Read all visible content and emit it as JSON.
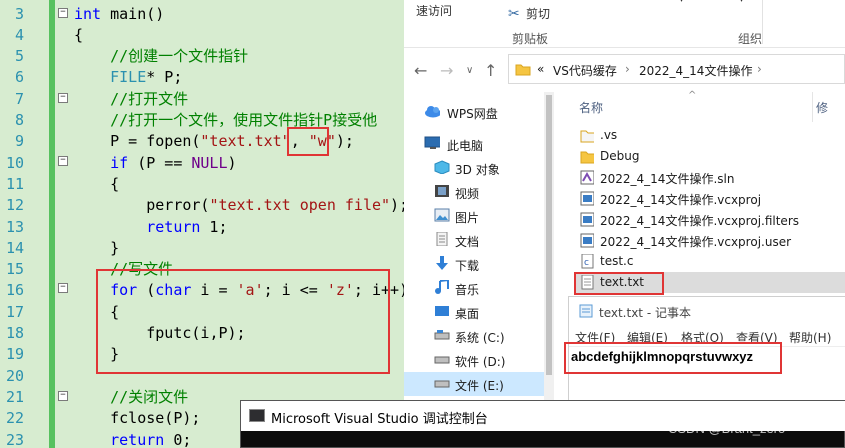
{
  "editor": {
    "lines": [
      {
        "n": "3",
        "tokens": [
          {
            "t": "int",
            "c": "kw"
          },
          {
            "t": " main()",
            "c": ""
          }
        ]
      },
      {
        "n": "4",
        "tokens": [
          {
            "t": "{",
            "c": ""
          }
        ]
      },
      {
        "n": "5",
        "tokens": [
          {
            "t": "    //创建一个文件指针",
            "c": "cm"
          }
        ]
      },
      {
        "n": "6",
        "tokens": [
          {
            "t": "    ",
            "c": ""
          },
          {
            "t": "FILE",
            "c": "ty"
          },
          {
            "t": "* P;",
            "c": ""
          }
        ]
      },
      {
        "n": "7",
        "tokens": [
          {
            "t": "    //打开文件",
            "c": "cm"
          }
        ]
      },
      {
        "n": "8",
        "tokens": [
          {
            "t": "    //打开一个文件，使用文件指针P接受他",
            "c": "cm"
          }
        ]
      },
      {
        "n": "9",
        "tokens": [
          {
            "t": "    P = fopen(",
            "c": ""
          },
          {
            "t": "\"text.txt\"",
            "c": "st"
          },
          {
            "t": ", ",
            "c": ""
          },
          {
            "t": "\"w\"",
            "c": "st"
          },
          {
            "t": ");",
            "c": ""
          }
        ]
      },
      {
        "n": "10",
        "tokens": [
          {
            "t": "    ",
            "c": ""
          },
          {
            "t": "if",
            "c": "kw"
          },
          {
            "t": " (P == ",
            "c": ""
          },
          {
            "t": "NULL",
            "c": "mc"
          },
          {
            "t": ")",
            "c": ""
          }
        ]
      },
      {
        "n": "11",
        "tokens": [
          {
            "t": "    {",
            "c": ""
          }
        ]
      },
      {
        "n": "12",
        "tokens": [
          {
            "t": "        perror(",
            "c": ""
          },
          {
            "t": "\"text.txt open file\"",
            "c": "st"
          },
          {
            "t": ");",
            "c": ""
          }
        ]
      },
      {
        "n": "13",
        "tokens": [
          {
            "t": "        ",
            "c": ""
          },
          {
            "t": "return",
            "c": "kw"
          },
          {
            "t": " 1;",
            "c": ""
          }
        ]
      },
      {
        "n": "14",
        "tokens": [
          {
            "t": "    }",
            "c": ""
          }
        ]
      },
      {
        "n": "15",
        "tokens": [
          {
            "t": "    //写文件",
            "c": "cm"
          }
        ]
      },
      {
        "n": "16",
        "tokens": [
          {
            "t": "    ",
            "c": ""
          },
          {
            "t": "for",
            "c": "kw"
          },
          {
            "t": " (",
            "c": ""
          },
          {
            "t": "char",
            "c": "kw"
          },
          {
            "t": " i = ",
            "c": ""
          },
          {
            "t": "'a'",
            "c": "st"
          },
          {
            "t": "; i <= ",
            "c": ""
          },
          {
            "t": "'z'",
            "c": "st"
          },
          {
            "t": "; i++)",
            "c": ""
          }
        ]
      },
      {
        "n": "17",
        "tokens": [
          {
            "t": "    {",
            "c": ""
          }
        ]
      },
      {
        "n": "18",
        "tokens": [
          {
            "t": "        fputc(i,P);",
            "c": ""
          }
        ]
      },
      {
        "n": "19",
        "tokens": [
          {
            "t": "    }",
            "c": ""
          }
        ]
      },
      {
        "n": "20",
        "tokens": []
      },
      {
        "n": "21",
        "tokens": [
          {
            "t": "    //关闭文件",
            "c": "cm"
          }
        ]
      },
      {
        "n": "22",
        "tokens": [
          {
            "t": "    fclose(P);",
            "c": ""
          }
        ]
      },
      {
        "n": "23",
        "tokens": [
          {
            "t": "    ",
            "c": ""
          },
          {
            "t": "return",
            "c": "kw"
          },
          {
            "t": " 0;",
            "c": ""
          }
        ]
      }
    ]
  },
  "explorer": {
    "ribbon": {
      "quick_access": "速访问",
      "cut": "剪切",
      "clipboard_group": "剪贴板",
      "organize_group": "组织"
    },
    "address": {
      "prefix": "«",
      "segments": [
        "VS代码缓存",
        "2022_4_14文件操作"
      ]
    },
    "nav_items": [
      {
        "label": "WPS网盘",
        "icon": "cloud-icon"
      },
      {
        "label": "此电脑",
        "icon": "computer-icon"
      },
      {
        "label": "3D 对象",
        "icon": "cube-icon"
      },
      {
        "label": "视频",
        "icon": "video-icon"
      },
      {
        "label": "图片",
        "icon": "picture-icon"
      },
      {
        "label": "文档",
        "icon": "document-icon"
      },
      {
        "label": "下载",
        "icon": "download-icon"
      },
      {
        "label": "音乐",
        "icon": "music-icon"
      },
      {
        "label": "桌面",
        "icon": "desktop-icon"
      },
      {
        "label": "系统 (C:)",
        "icon": "drive-icon"
      },
      {
        "label": "软件 (D:)",
        "icon": "drive-icon"
      },
      {
        "label": "文件 (E:)",
        "icon": "drive-icon"
      }
    ],
    "column_name": "名称",
    "column_more": "修",
    "files": [
      {
        "name": ".vs",
        "icon": "folder-icon"
      },
      {
        "name": "Debug",
        "icon": "folder-icon"
      },
      {
        "name": "2022_4_14文件操作.sln",
        "icon": "solution-icon"
      },
      {
        "name": "2022_4_14文件操作.vcxproj",
        "icon": "project-icon"
      },
      {
        "name": "2022_4_14文件操作.vcxproj.filters",
        "icon": "project-icon"
      },
      {
        "name": "2022_4_14文件操作.vcxproj.user",
        "icon": "project-icon"
      },
      {
        "name": "test.c",
        "icon": "c-file-icon"
      },
      {
        "name": "text.txt",
        "icon": "text-file-icon"
      }
    ]
  },
  "notepad": {
    "title": "text.txt - 记事本",
    "menu": [
      "文件(F)",
      "编辑(E)",
      "格式(O)",
      "查看(V)",
      "帮助(H)"
    ],
    "content": "abcdefghijklmnopqrstuvwxyz"
  },
  "console": {
    "title": "Microsoft Visual Studio 调试控制台"
  },
  "watermark": "CSDN @Brant_zero",
  "colors": {
    "editor_bg": "#d7ecd0",
    "keyword": "#0000ff",
    "comment": "#008000",
    "string": "#a31515",
    "highlight_box": "#e03535"
  }
}
